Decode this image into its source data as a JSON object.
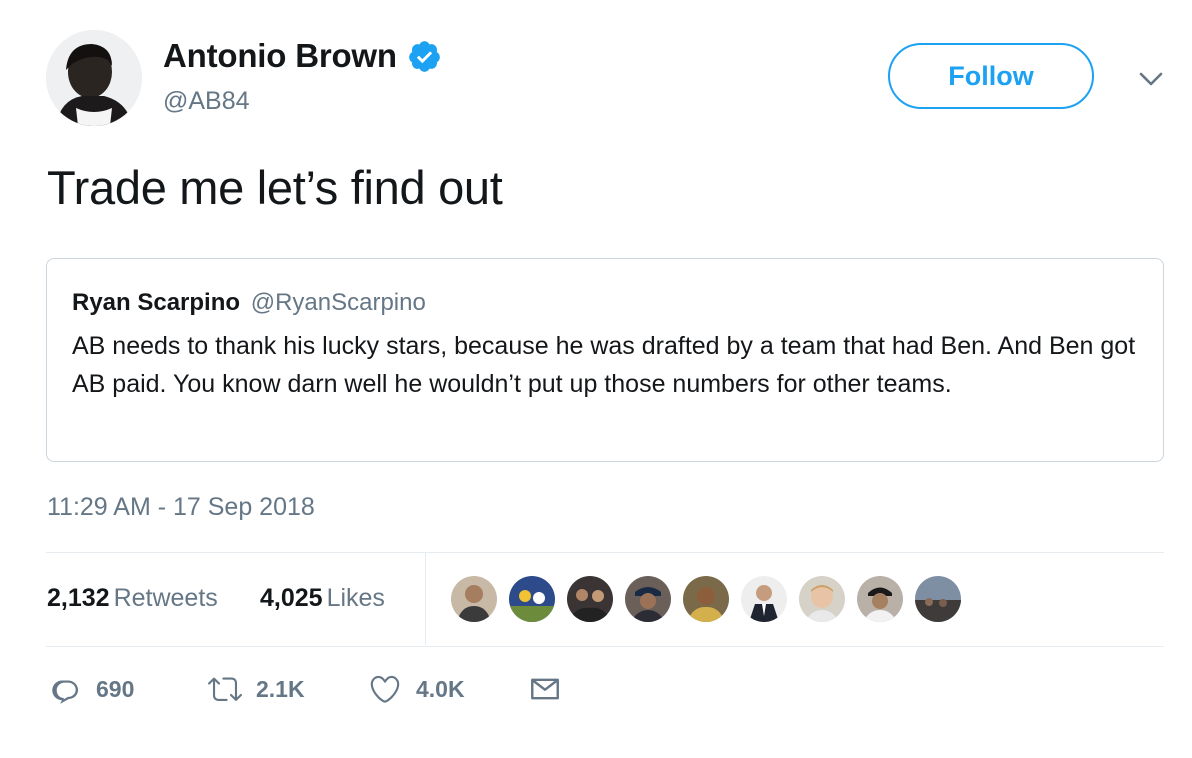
{
  "author": {
    "name": "Antonio Brown",
    "handle": "@AB84",
    "verified": true
  },
  "follow_label": "Follow",
  "tweet_text": "Trade me let’s find out",
  "quoted_tweet": {
    "name": "Ryan Scarpino",
    "handle": "@RyanScarpino",
    "text": "AB needs to thank his lucky stars, because he was drafted by a team that had Ben. And Ben got AB paid. You know darn well he wouldn’t put up those numbers for other teams."
  },
  "timestamp": "11:29 AM - 17 Sep 2018",
  "stats": {
    "retweets_count": "2,132",
    "retweets_label": "Retweets",
    "likes_count": "4,025",
    "likes_label": "Likes"
  },
  "actions": {
    "reply_count": "690",
    "retweet_count": "2.1K",
    "like_count": "4.0K"
  },
  "colors": {
    "accent": "#1da1f2",
    "secondary_text": "#657786",
    "primary_text": "#14171a",
    "border": "#ccd6dd"
  },
  "icons": [
    "verified-badge-icon",
    "chevron-down-icon",
    "reply-icon",
    "retweet-icon",
    "like-icon",
    "direct-message-icon"
  ]
}
